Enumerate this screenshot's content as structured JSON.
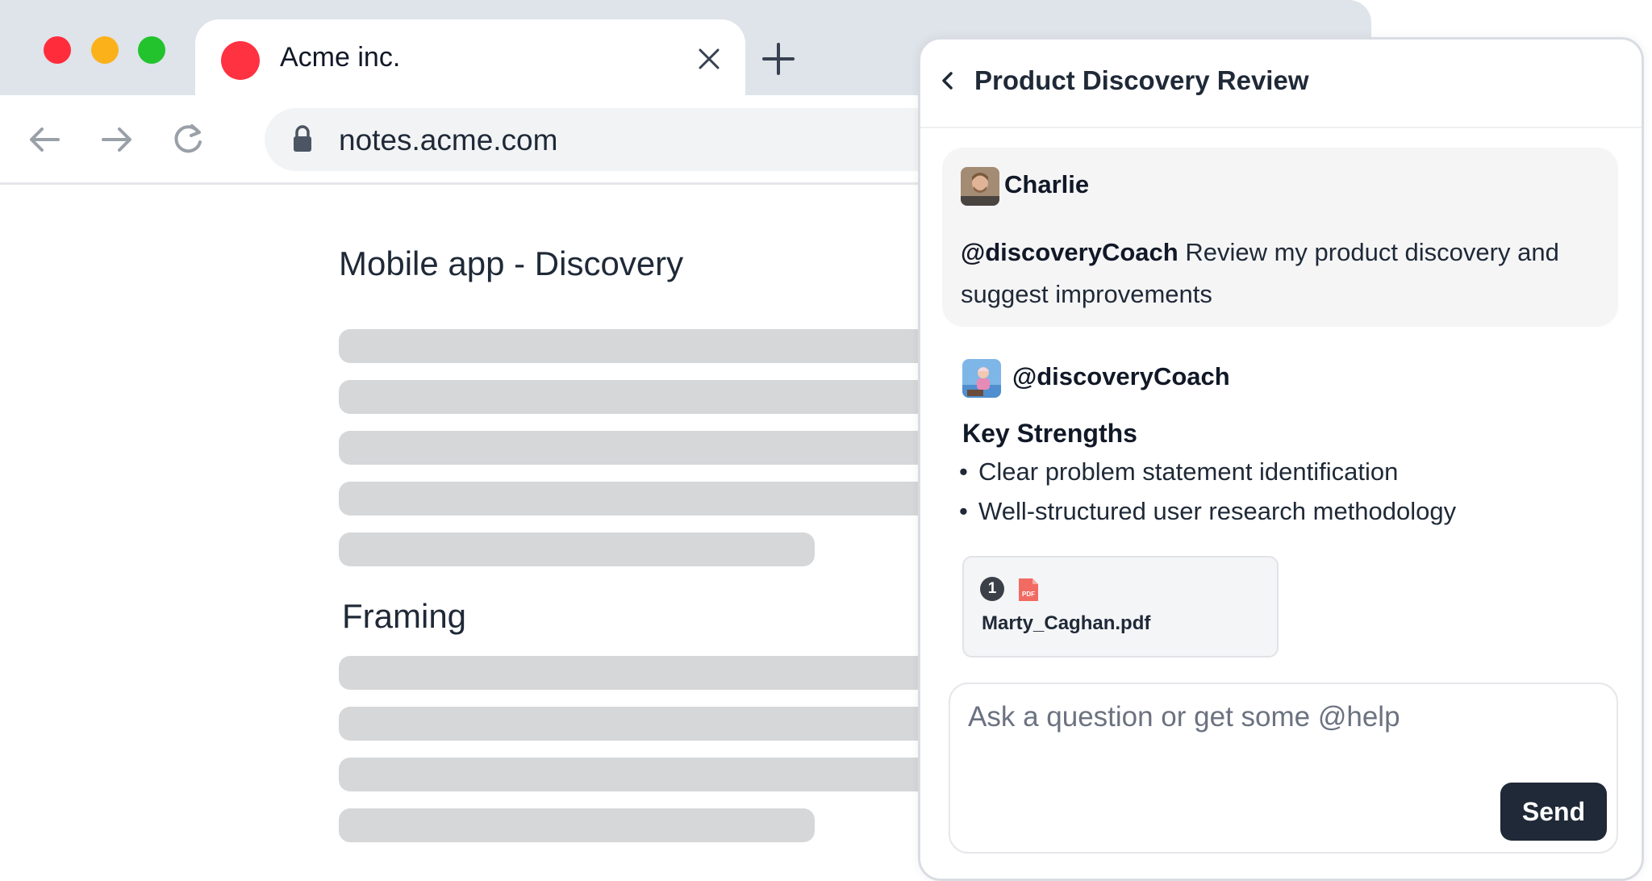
{
  "browser": {
    "tab": {
      "title": "Acme inc.",
      "favicon_color": "#ff3241"
    },
    "url": "notes.acme.com",
    "traffic_lights": [
      "#ff2d3b",
      "#fbb11a",
      "#22c32d"
    ]
  },
  "document": {
    "title": "Mobile app - Discovery",
    "section_heading": "Framing"
  },
  "chat": {
    "header_title": "Product Discovery Review",
    "user_message": {
      "author": "Charlie",
      "mention": "@discoveryCoach",
      "text": " Review my product discovery and suggest improvements"
    },
    "bot_message": {
      "author": "@discoveryCoach",
      "heading": "Key Strengths",
      "bullets": [
        "Clear problem statement identification",
        "Well-structured user research methodology"
      ],
      "attachment": {
        "count": "1",
        "icon": "pdf-icon",
        "file_name": "Marty_Caghan.pdf"
      }
    },
    "composer": {
      "placeholder": "Ask a question or get some @help",
      "send_label": "Send"
    }
  },
  "colors": {
    "accent_dark": "#1f2937",
    "skeleton": "#d6d7d9",
    "chrome": "#dfe3ea"
  }
}
